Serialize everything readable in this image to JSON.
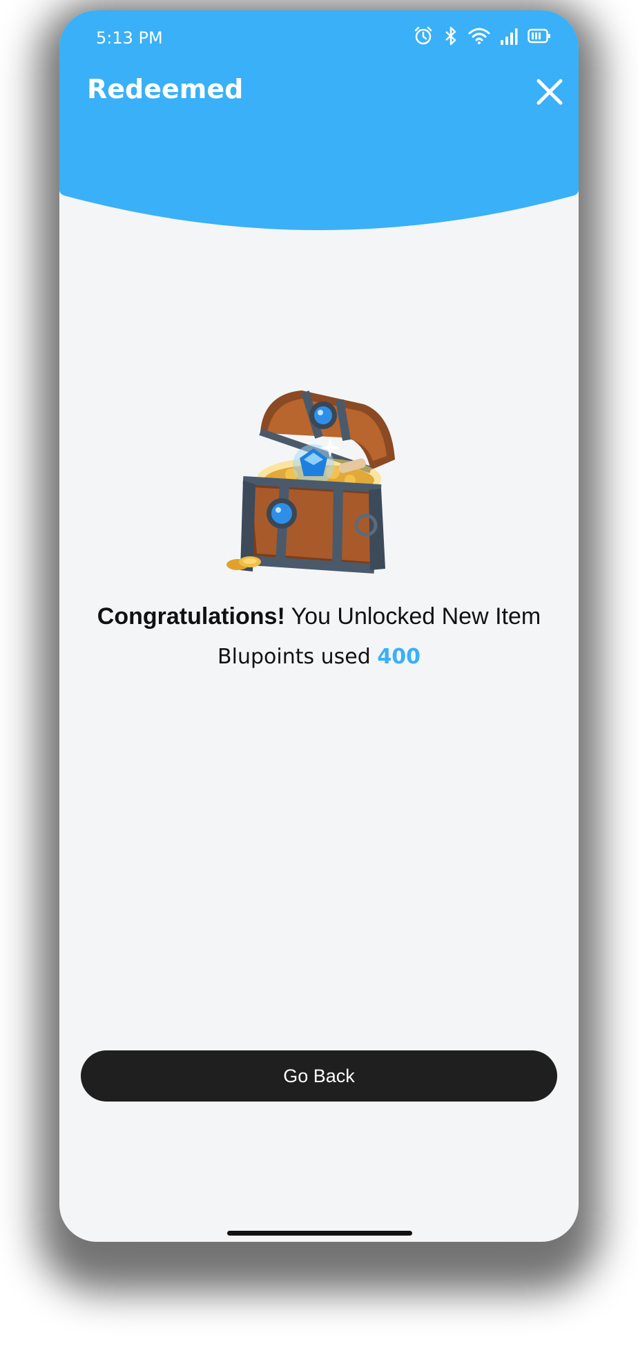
{
  "status_bar": {
    "time": "5:13 PM",
    "icons": [
      "alarm-icon",
      "bluetooth-icon",
      "wifi-icon",
      "signal-icon",
      "battery-icon"
    ]
  },
  "header": {
    "title": "Redeemed",
    "close_icon": "close-icon"
  },
  "colors": {
    "header_blue": "#39b0f7",
    "background": "#f4f5f6",
    "button": "#1f1f1f",
    "accent": "#39b0f7"
  },
  "reward": {
    "image": "treasure-chest-icon",
    "congrats_bold": "Congratulations!",
    "congrats_rest": " You Unlocked New Item",
    "points_label": "Blupoints used ",
    "points_value": "400"
  },
  "actions": {
    "go_back_label": "Go Back"
  }
}
